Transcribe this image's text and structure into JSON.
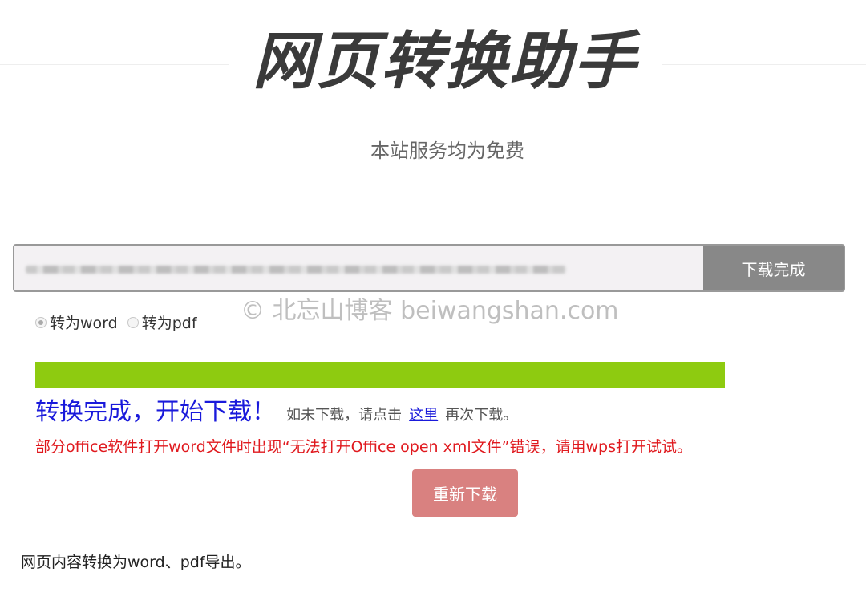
{
  "header": {
    "title": "网页转换助手",
    "subtitle": "本站服务均为免费"
  },
  "url_bar": {
    "download_button_label": "下载完成"
  },
  "watermark": "© 北忘山博客 beiwangshan.com",
  "format_options": [
    {
      "label": "转为word",
      "selected": true
    },
    {
      "label": "转为pdf",
      "selected": false
    }
  ],
  "progress": {
    "percent": 100,
    "fill_color": "#8ecb10"
  },
  "status": {
    "main": "转换完成，开始下载！",
    "hint_before": "如未下载，请点击",
    "link": "这里",
    "hint_after": "再次下载。"
  },
  "warning": "部分office软件打开word文件时出现“无法打开Office open xml文件”错误，请用wps打开试试。",
  "redownload_button_label": "重新下载",
  "footer": "网页内容转换为word、pdf导出。",
  "colors": {
    "status_blue": "#1a1adb",
    "warning_red": "#e0191e",
    "redownload_bg": "#d98180",
    "download_bg": "#888888"
  }
}
